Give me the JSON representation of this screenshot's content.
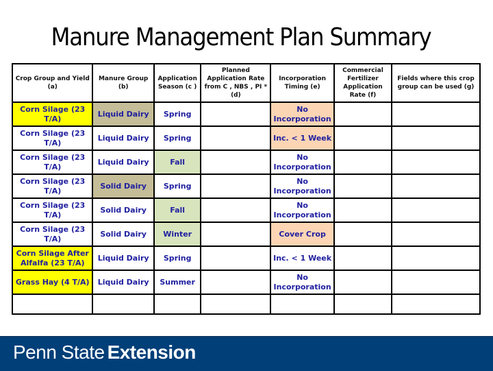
{
  "title": "Manure Management Plan Summary",
  "table": {
    "headers": [
      "Crop Group and Yield (a)",
      "Manure Group (b)",
      "Application Season (c )",
      "Planned Application Rate from C , NBS , PI * (d)",
      "Incorporation Timing (e)",
      "Commercial Fertilizer Application Rate (f)",
      "Fields where this crop group can be used (g)"
    ],
    "rows": [
      {
        "crop": "Corn Silage (23 T/A)",
        "manure": "Liquid Dairy",
        "season": "Spring",
        "rate": "",
        "incorporation": "No Incorporation",
        "fertilizer": "",
        "fields": ""
      },
      {
        "crop": "Corn Silage (23 T/A)",
        "manure": "Liquid Dairy",
        "season": "Spring",
        "rate": "",
        "incorporation": "Inc. < 1 Week",
        "fertilizer": "",
        "fields": ""
      },
      {
        "crop": "Corn Silage (23 T/A)",
        "manure": "Liquid Dairy",
        "season": "Fall",
        "rate": "",
        "incorporation": "No Incorporation",
        "fertilizer": "",
        "fields": ""
      },
      {
        "crop": "Corn Silage (23 T/A)",
        "manure": "Solid Dairy",
        "season": "Spring",
        "rate": "",
        "incorporation": "No Incorporation",
        "fertilizer": "",
        "fields": ""
      },
      {
        "crop": "Corn Silage (23 T/A)",
        "manure": "Solid Dairy",
        "season": "Fall",
        "rate": "",
        "incorporation": "No Incorporation",
        "fertilizer": "",
        "fields": ""
      },
      {
        "crop": "Corn Silage (23 T/A)",
        "manure": "Solid Dairy",
        "season": "Winter",
        "rate": "",
        "incorporation": "Cover Crop",
        "fertilizer": "",
        "fields": ""
      },
      {
        "crop": "Corn Silage After Alfalfa (23 T/A)",
        "manure": "Liquid Dairy",
        "season": "Spring",
        "rate": "",
        "incorporation": "Inc. < 1 Week",
        "fertilizer": "",
        "fields": ""
      },
      {
        "crop": "Grass Hay (4 T/A)",
        "manure": "Liquid Dairy",
        "season": "Summer",
        "rate": "",
        "incorporation": "No Incorporation",
        "fertilizer": "",
        "fields": ""
      }
    ]
  },
  "highlight_colors": {
    "crop_highlight": "#ffff00",
    "manure_highlight": "#c4bd97",
    "season_highlight": "#d7e4bc",
    "incorporation_highlight": "#fcd5b4",
    "cell_text": "#1f1f9f"
  },
  "footer": {
    "brand_light": "Penn State",
    "brand_bold": "Extension",
    "background": "#003f78"
  }
}
